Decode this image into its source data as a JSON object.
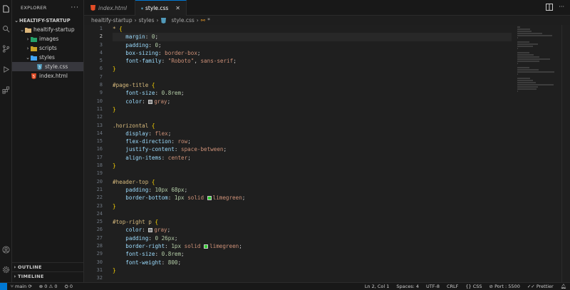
{
  "explorer": {
    "title": "EXPLORER",
    "more": "···",
    "root": "HEALTIFY-STARTUP",
    "items": [
      {
        "label": "healtify-startup",
        "type": "folder-open"
      },
      {
        "label": "images",
        "type": "folder"
      },
      {
        "label": "scripts",
        "type": "folder"
      },
      {
        "label": "styles",
        "type": "folder-open"
      },
      {
        "label": "style.css",
        "type": "css"
      },
      {
        "label": "index.html",
        "type": "html"
      }
    ],
    "outline": "OUTLINE",
    "timeline": "TIMELINE"
  },
  "tabs": [
    {
      "label": "index.html",
      "active": false
    },
    {
      "label": "style.css",
      "active": true,
      "close": "✕"
    }
  ],
  "breadcrumb": [
    "healtify-startup",
    "styles",
    "style.css",
    "*"
  ],
  "code": {
    "current_line": 2,
    "lines": [
      [
        [
          "sel",
          "*"
        ],
        [
          "txt",
          " "
        ],
        [
          "brace",
          "{"
        ]
      ],
      [
        [
          "txt",
          "    "
        ],
        [
          "prop",
          "margin"
        ],
        [
          "txt",
          ": "
        ],
        [
          "num",
          "0"
        ],
        [
          "txt",
          ";"
        ]
      ],
      [
        [
          "txt",
          "    "
        ],
        [
          "prop",
          "padding"
        ],
        [
          "txt",
          ": "
        ],
        [
          "num",
          "0"
        ],
        [
          "txt",
          ";"
        ]
      ],
      [
        [
          "txt",
          "    "
        ],
        [
          "prop",
          "box-sizing"
        ],
        [
          "txt",
          ": "
        ],
        [
          "val",
          "border-box"
        ],
        [
          "txt",
          ";"
        ]
      ],
      [
        [
          "txt",
          "    "
        ],
        [
          "prop",
          "font-family"
        ],
        [
          "txt",
          ": "
        ],
        [
          "val",
          "\"Roboto\""
        ],
        [
          "txt",
          ", "
        ],
        [
          "val",
          "sans-serif"
        ],
        [
          "txt",
          ";"
        ]
      ],
      [
        [
          "brace",
          "}"
        ]
      ],
      [],
      [
        [
          "sel",
          "#page-title"
        ],
        [
          "txt",
          " "
        ],
        [
          "brace",
          "{"
        ]
      ],
      [
        [
          "txt",
          "    "
        ],
        [
          "prop",
          "font-size"
        ],
        [
          "txt",
          ": "
        ],
        [
          "num",
          "0.8rem"
        ],
        [
          "txt",
          ";"
        ]
      ],
      [
        [
          "txt",
          "    "
        ],
        [
          "prop",
          "color"
        ],
        [
          "txt",
          ": "
        ],
        [
          "swatch",
          "#808080"
        ],
        [
          "val",
          "gray"
        ],
        [
          "txt",
          ";"
        ]
      ],
      [
        [
          "brace",
          "}"
        ]
      ],
      [],
      [
        [
          "sel",
          ".horizontal"
        ],
        [
          "txt",
          " "
        ],
        [
          "brace",
          "{"
        ]
      ],
      [
        [
          "txt",
          "    "
        ],
        [
          "prop",
          "display"
        ],
        [
          "txt",
          ": "
        ],
        [
          "val",
          "flex"
        ],
        [
          "txt",
          ";"
        ]
      ],
      [
        [
          "txt",
          "    "
        ],
        [
          "prop",
          "flex-direction"
        ],
        [
          "txt",
          ": "
        ],
        [
          "val",
          "row"
        ],
        [
          "txt",
          ";"
        ]
      ],
      [
        [
          "txt",
          "    "
        ],
        [
          "prop",
          "justify-content"
        ],
        [
          "txt",
          ": "
        ],
        [
          "val",
          "space-between"
        ],
        [
          "txt",
          ";"
        ]
      ],
      [
        [
          "txt",
          "    "
        ],
        [
          "prop",
          "align-items"
        ],
        [
          "txt",
          ": "
        ],
        [
          "val",
          "center"
        ],
        [
          "txt",
          ";"
        ]
      ],
      [
        [
          "brace",
          "}"
        ]
      ],
      [],
      [
        [
          "sel",
          "#header-top"
        ],
        [
          "txt",
          " "
        ],
        [
          "brace",
          "{"
        ]
      ],
      [
        [
          "txt",
          "    "
        ],
        [
          "prop",
          "padding"
        ],
        [
          "txt",
          ": "
        ],
        [
          "num",
          "10px 68px"
        ],
        [
          "txt",
          ";"
        ]
      ],
      [
        [
          "txt",
          "    "
        ],
        [
          "prop",
          "border-bottom"
        ],
        [
          "txt",
          ": "
        ],
        [
          "num",
          "1px"
        ],
        [
          "txt",
          " "
        ],
        [
          "val",
          "solid"
        ],
        [
          "txt",
          " "
        ],
        [
          "swatch",
          "#32cd32"
        ],
        [
          "val",
          "limegreen"
        ],
        [
          "txt",
          ";"
        ]
      ],
      [
        [
          "brace",
          "}"
        ]
      ],
      [],
      [
        [
          "sel",
          "#top-right p"
        ],
        [
          "txt",
          " "
        ],
        [
          "brace",
          "{"
        ]
      ],
      [
        [
          "txt",
          "    "
        ],
        [
          "prop",
          "color"
        ],
        [
          "txt",
          ": "
        ],
        [
          "swatch",
          "#808080"
        ],
        [
          "val",
          "gray"
        ],
        [
          "txt",
          ";"
        ]
      ],
      [
        [
          "txt",
          "    "
        ],
        [
          "prop",
          "padding"
        ],
        [
          "txt",
          ": "
        ],
        [
          "num",
          "0 26px"
        ],
        [
          "txt",
          ";"
        ]
      ],
      [
        [
          "txt",
          "    "
        ],
        [
          "prop",
          "border-right"
        ],
        [
          "txt",
          ": "
        ],
        [
          "num",
          "1px"
        ],
        [
          "txt",
          " "
        ],
        [
          "val",
          "solid"
        ],
        [
          "txt",
          " "
        ],
        [
          "swatch",
          "#32cd32"
        ],
        [
          "val",
          "limegreen"
        ],
        [
          "txt",
          ";"
        ]
      ],
      [
        [
          "txt",
          "    "
        ],
        [
          "prop",
          "font-size"
        ],
        [
          "txt",
          ": "
        ],
        [
          "num",
          "0.8rem"
        ],
        [
          "txt",
          ";"
        ]
      ],
      [
        [
          "txt",
          "    "
        ],
        [
          "prop",
          "font-weight"
        ],
        [
          "txt",
          ": "
        ],
        [
          "num",
          "800"
        ],
        [
          "txt",
          ";"
        ]
      ],
      [
        [
          "brace",
          "}"
        ]
      ],
      []
    ]
  },
  "status": {
    "branch": "main",
    "errors": "0",
    "warnings": "0",
    "ports_count": "0",
    "position": "Ln 2, Col 1",
    "spaces": "Spaces: 4",
    "encoding": "UTF-8",
    "eol": "CRLF",
    "language": "CSS",
    "port": "Port : 5500",
    "formatter": "Prettier"
  },
  "colors": {
    "accent": "#0078d4",
    "css_icon": "#519aba",
    "html_icon": "#e44d26",
    "folder": "#dcb67a"
  }
}
